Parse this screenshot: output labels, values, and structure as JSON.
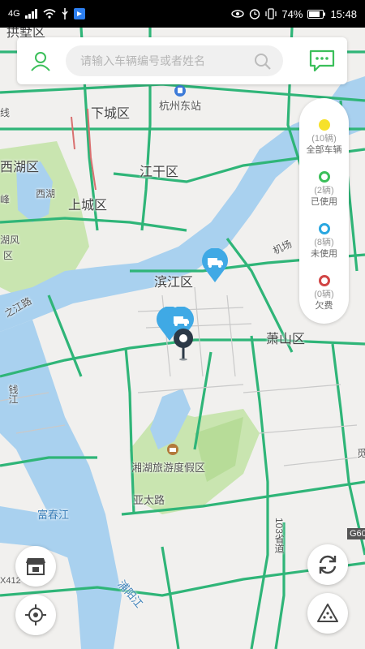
{
  "status_bar": {
    "left_icons": [
      "signal-icon",
      "wifi-icon",
      "usb-icon",
      "app-notification-icon"
    ],
    "network_label": "4G",
    "battery": "74%",
    "time": "15:48"
  },
  "search": {
    "placeholder": "请输入车辆编号或者姓名",
    "user_icon": "user-icon",
    "search_icon": "search-icon",
    "message_icon": "message-icon"
  },
  "legend": {
    "items": [
      {
        "count": "(10辆)",
        "label": "全部车辆",
        "color": "#f6e12a"
      },
      {
        "count": "(2辆)",
        "label": "已使用",
        "color": "#3bbf5a"
      },
      {
        "count": "(8辆)",
        "label": "未使用",
        "color": "#2aa7e0"
      },
      {
        "count": "(0辆)",
        "label": "欠费",
        "color": "#d14545"
      }
    ]
  },
  "map": {
    "labels": {
      "gongshu": "拱墅区",
      "xiacheng": "下城区",
      "hangzhou_east": "杭州东站",
      "jianggan": "江干区",
      "xihu_district": "西湖区",
      "xihu_lake": "西湖",
      "shangcheng": "上城区",
      "feng": "峰",
      "hupan": "湖风",
      "qu": "区",
      "binjiang": "滨江区",
      "zhijiang": "之江路",
      "airport": "机场",
      "xiaoshan": "萧山区",
      "qianjiang": "钱江",
      "xianghu": "湘湖旅游度假区",
      "yatai": "亚太路",
      "fuchun": "富春江",
      "puyang": "浦阳江",
      "g60": "G60",
      "road_103": "103省道",
      "x412": "X412",
      "line": "线",
      "mi": "觅"
    }
  },
  "controls": {
    "shop_icon": "shop-icon",
    "locate_icon": "locate-icon",
    "refresh_icon": "refresh-icon",
    "layers_icon": "layers-icon"
  },
  "colors": {
    "accent": "#3bbf5a",
    "pin": "#3fa9e5",
    "road": "#2fb578",
    "water": "#9cc9ec",
    "green": "#c9e5b0"
  }
}
